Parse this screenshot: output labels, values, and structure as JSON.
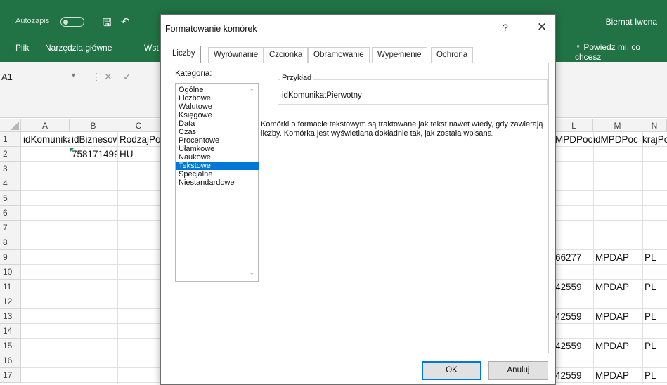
{
  "titlebar": {
    "autosave": "Autozapis",
    "user": "Biernat Iwona"
  },
  "menu": [
    "Plik",
    "Narzędzia główne",
    "Wst"
  ],
  "tell_me": "Powiedz mi, co chcesz",
  "name_box": "A1",
  "columns_left": [
    "A",
    "B",
    "C"
  ],
  "columns_right": [
    "L",
    "M",
    "N"
  ],
  "rows": [
    "1",
    "2",
    "3",
    "4",
    "5",
    "6",
    "7",
    "8",
    "9",
    "10",
    "11",
    "12",
    "13",
    "14",
    "15",
    "16",
    "17"
  ],
  "cells": {
    "A1": "idKomunikatPierwotny",
    "B1": "idBiznesowy",
    "C1": "RodzajPo",
    "B2": "758171499",
    "C2": "HU",
    "L1": "MPDPoc",
    "M1": "idMPDPoc",
    "N1": "krajPo",
    "L9": "66277",
    "M9": "MPDAP",
    "N9": "PL",
    "L11": "42559",
    "M11": "MPDAP",
    "N11": "PL",
    "L13": "42559",
    "M13": "MPDAP",
    "N13": "PL",
    "L15": "42559",
    "M15": "MPDAP",
    "N15": "PL",
    "L17": "42559",
    "M17": "MPDAP",
    "N17": "PL"
  },
  "dialog": {
    "title": "Formatowanie komórek",
    "help": "?",
    "close": "✕",
    "tabs": [
      "Liczby",
      "Wyrównanie",
      "Czcionka",
      "Obramowanie",
      "Wypełnienie",
      "Ochrona"
    ],
    "active_tab": "Liczby",
    "category_label": "Kategoria:",
    "categories": [
      "Ogólne",
      "Liczbowe",
      "Walutowe",
      "Księgowe",
      "Data",
      "Czas",
      "Procentowe",
      "Ułamkowe",
      "Naukowe",
      "Tekstowe",
      "Specjalne",
      "Niestandardowe"
    ],
    "selected_category": "Tekstowe",
    "sample_label": "Przykład",
    "sample_value": "idKomunikatPierwotny",
    "description": "Komórki o formacie tekstowym są traktowane jak tekst nawet wtedy, gdy zawierają liczby. Komórka jest wyświetlana dokładnie tak, jak została wpisana.",
    "ok": "OK",
    "cancel": "Anuluj"
  },
  "icons": [
    "save-icon",
    "undo-icon",
    "lightbulb-icon",
    "cancel-formula-icon",
    "confirm-formula-icon"
  ],
  "colors": {
    "excel_green": "#217346",
    "selection": "#0078d7"
  }
}
